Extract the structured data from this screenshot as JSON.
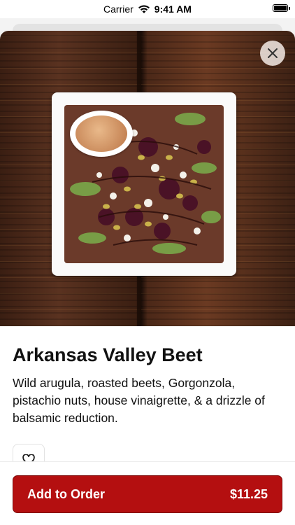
{
  "status_bar": {
    "carrier": "Carrier",
    "time": "9:41 AM",
    "icons": [
      "wifi-icon",
      "battery-icon"
    ]
  },
  "item": {
    "image_alt": "Arkansas Valley Beet salad",
    "title": "Arkansas Valley Beet",
    "description": "Wild arugula, roasted beets, Gorgonzola, pistachio nuts, house vinaigrette, & a drizzle of balsamic reduction."
  },
  "actions": {
    "close_icon": "close-icon",
    "favorite_icon": "heart-icon"
  },
  "footer": {
    "add_label": "Add to Order",
    "price": "$11.25"
  },
  "colors": {
    "primary": "#b40f10",
    "text": "#111111"
  }
}
